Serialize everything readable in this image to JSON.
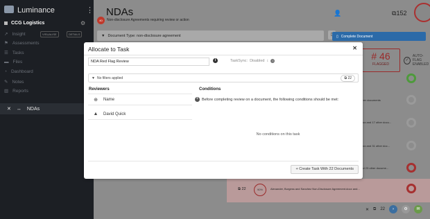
{
  "sidebar": {
    "app_name": "Luminance",
    "org_name": "CCG Logistics",
    "insight_label": "Insight",
    "visualise_label": "VISUALISE",
    "details_label": "DETAILS",
    "items": [
      {
        "label": "Assessments"
      },
      {
        "label": "Tasks"
      },
      {
        "label": "Files"
      },
      {
        "label": "Dashboard"
      },
      {
        "label": "Notes"
      },
      {
        "label": "Reports"
      }
    ],
    "open_tab": "NDAs"
  },
  "main": {
    "title": "NDAs",
    "subtitle": "Non-disclosure Agreements requiring review or action",
    "badge": "40",
    "user_count": "152",
    "filter_label": "Document Type: non-disclosure agreement",
    "complete_button": "Complete Document",
    "flagged_number": "# 46",
    "flagged_label": "FLAGGED",
    "auto_flag_line1": "AUTO-FLAG",
    "auto_flag_line2": "ENABLED",
    "rows": [
      {
        "text": "other documents"
      },
      {
        "text": "docx and 17 other docu..."
      },
      {
        "text": "docx and 31 other doc..."
      },
      {
        "text": "and 23 other docume..."
      }
    ],
    "bottom_count": "22",
    "bottom_pct": "90%",
    "bottom_doc": "Alexander, Burgess and Sanchez Non-Disclosure Agreement.docx and...",
    "toolbar_count": "22"
  },
  "modal": {
    "title": "Allocate to Task",
    "task_name": "NDA Red Flag Review",
    "tasksync_label": "TaskSync:",
    "tasksync_value": "Disabled",
    "filter_text": "No filters applied",
    "filter_count": "22",
    "reviewers_header": "Reviewers",
    "conditions_header": "Conditions",
    "reviewers": [
      {
        "name": "Name",
        "icon": "plus-icon"
      },
      {
        "name": "David Quick",
        "icon": "person-icon"
      }
    ],
    "condition_hint": "Before completing review on a document, the following conditions should be met:",
    "empty_conditions": "No conditions on this task",
    "create_button": "+ Create Task With 22 Documents"
  }
}
